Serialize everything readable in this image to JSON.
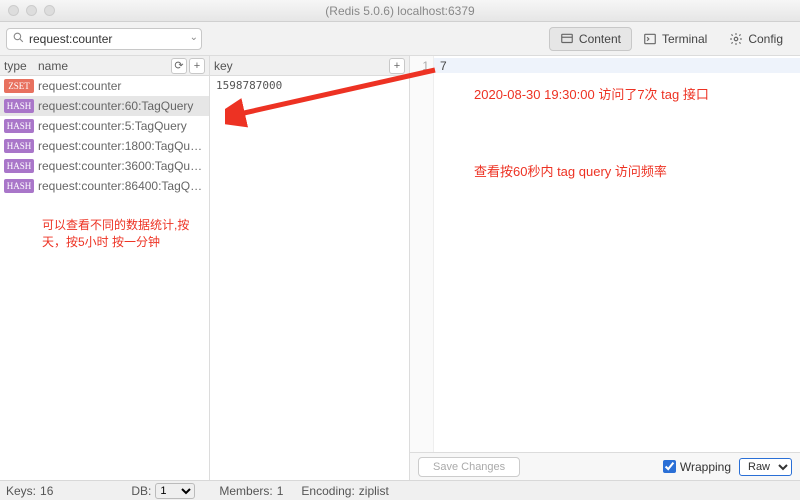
{
  "window": {
    "title": "(Redis 5.0.6) localhost:6379"
  },
  "search": {
    "placeholder": "",
    "value": "request:counter"
  },
  "tabs": {
    "content": "Content",
    "terminal": "Terminal",
    "config": "Config"
  },
  "left": {
    "head_type": "type",
    "head_name": "name",
    "rows": [
      {
        "type": "ZSET",
        "name": "request:counter"
      },
      {
        "type": "HASH",
        "name": "request:counter:60:TagQuery"
      },
      {
        "type": "HASH",
        "name": "request:counter:5:TagQuery"
      },
      {
        "type": "HASH",
        "name": "request:counter:1800:TagQue…"
      },
      {
        "type": "HASH",
        "name": "request:counter:3600:TagQu…"
      },
      {
        "type": "HASH",
        "name": "request:counter:86400:TagQ…"
      }
    ],
    "selected_index": 1
  },
  "mid": {
    "head": "key",
    "rows": [
      "1598787000"
    ]
  },
  "editor": {
    "line1_num": "1",
    "value": "7"
  },
  "annotations": {
    "left_note": "可以查看不同的数据统计,按天，按5小时 按一分钟",
    "right_note1": "2020-08-30 19:30:00 访问了7次 tag 接口",
    "right_note2": "查看按60秒内 tag query 访问频率"
  },
  "footer": {
    "save": "Save Changes",
    "wrapping": "Wrapping",
    "raw": "Raw"
  },
  "status": {
    "keys_label": "Keys:",
    "keys_val": "16",
    "db_label": "DB:",
    "db_val": "1",
    "members_label": "Members:",
    "members_val": "1",
    "encoding_label": "Encoding:",
    "encoding_val": "ziplist"
  }
}
